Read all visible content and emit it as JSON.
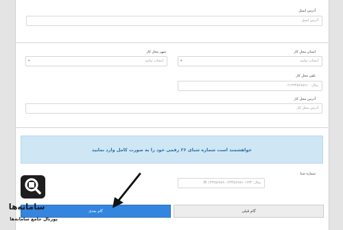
{
  "email_section": {
    "label": "آدرس ایمیل",
    "placeholder": "آدرس ایمیل"
  },
  "work_section": {
    "province_label": "استان محل کار",
    "province_value": "انتخاب نمایید",
    "city_label": "شهر محل کار",
    "city_value": "انتخاب نمایید",
    "phone_label": "تلفن محل کار",
    "phone_placeholder": "مثال: ۰۲۱۲۳۴۵۶۷۸۹۱۰",
    "address_label": "آدرس محل کار",
    "address_placeholder": "آدرس محل کار"
  },
  "sheba_section": {
    "notice": "خواهشمند است شماره شبای ۲۶ رقمی خود را به صورت کامل وارد نمایید",
    "label": "شماره شبا",
    "placeholder": "مثال: IR ۱۲۳۴۵۶۷۸۹۰۱۲۳۴۵۶۷۸۹۰۱۲۳۴"
  },
  "buttons": {
    "prev_label": "گام قبلی",
    "next_label": "گام بعدی"
  },
  "logo": {
    "title": "سامانه‌ها",
    "subtitle": "پورتال جامع سامانه‌ها"
  },
  "colors": {
    "accent": "#3385e0",
    "notice_bg": "#cfe6f4",
    "notice_text": "#2d6fa6"
  },
  "icons": {
    "arrow": "arrow-pointer-icon",
    "logo_mark": "search-magnifier-icon"
  }
}
